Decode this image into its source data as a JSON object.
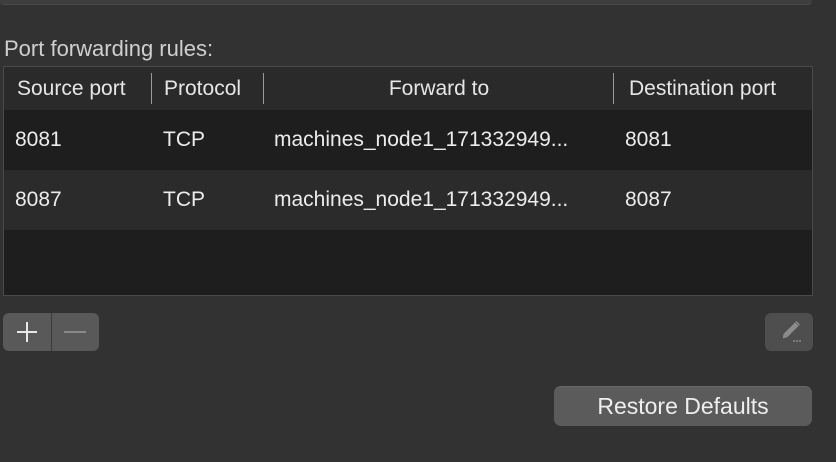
{
  "section_label": "Port forwarding rules:",
  "table": {
    "columns": [
      "Source port",
      "Protocol",
      "Forward to",
      "Destination port"
    ],
    "rows": [
      {
        "source_port": "8081",
        "protocol": "TCP",
        "forward_to": "machines_node1_171332949...",
        "destination_port": "8081"
      },
      {
        "source_port": "8087",
        "protocol": "TCP",
        "forward_to": "machines_node1_171332949...",
        "destination_port": "8087"
      }
    ]
  },
  "controls": {
    "add_icon": "plus-icon",
    "remove_icon": "minus-icon",
    "edit_icon": "pencil-icon",
    "restore_label": "Restore Defaults"
  },
  "colors": {
    "background": "#323232",
    "table_background": "#1e1e1e",
    "header_background": "#2a2a2a",
    "row_alt": "#2b2b2b",
    "button": "#5b5b5b",
    "text": "#e4e4e4"
  }
}
